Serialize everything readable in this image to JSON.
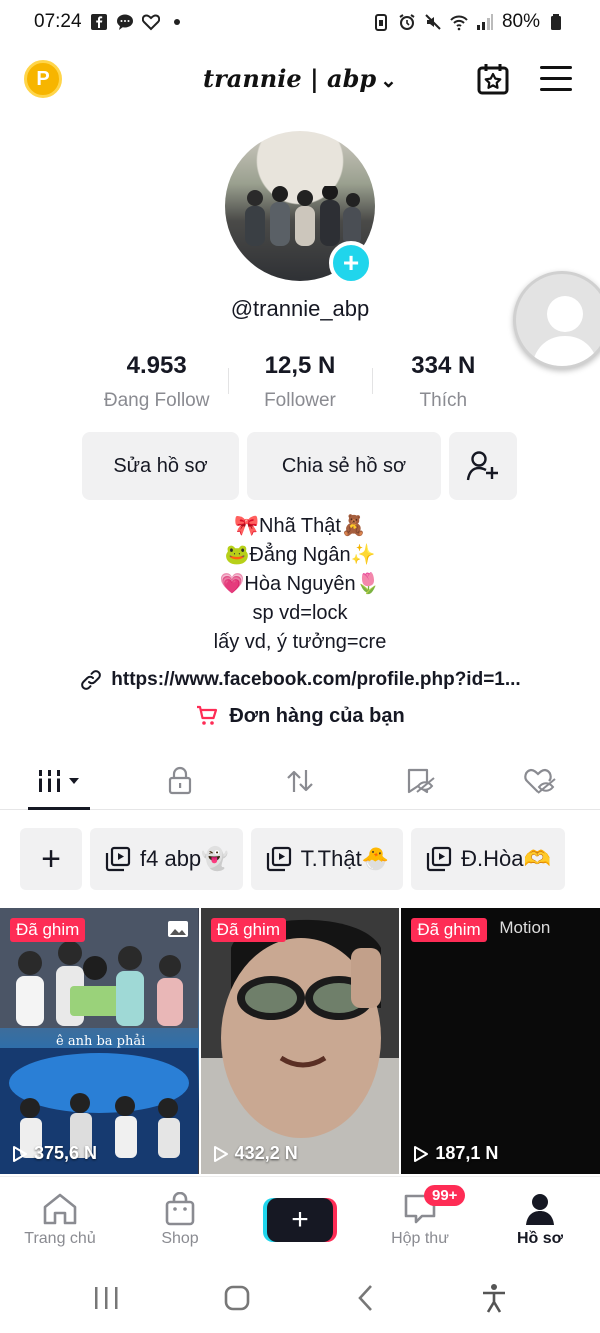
{
  "status_bar": {
    "time": "07:24",
    "battery": "80%"
  },
  "header": {
    "username": "trannie | abp",
    "coin_label": "P"
  },
  "profile": {
    "handle": "@trannie_abp",
    "stats": [
      {
        "value": "4.953",
        "label": "Đang Follow"
      },
      {
        "value": "12,5 N",
        "label": "Follower"
      },
      {
        "value": "334 N",
        "label": "Thích"
      }
    ],
    "edit_label": "Sửa hồ sơ",
    "share_label": "Chia sẻ hồ sơ",
    "bio": [
      "🎀Nhã Thật🧸",
      "🐸Đẳng Ngân✨",
      "💗Hòa Nguyên🌷",
      "sp vd=lock",
      "lấy vd, ý tưởng=cre"
    ],
    "link": "https://www.facebook.com/profile.php?id=1...",
    "orders": "Đơn hàng của bạn"
  },
  "collections": [
    {
      "label": "f4 abp👻"
    },
    {
      "label": "T.Thật🐣"
    },
    {
      "label": "Đ.Hòa🫶"
    }
  ],
  "videos": [
    {
      "pinned": "Đã ghim",
      "views": "375,6 N",
      "overlay": "ê anh ba phải"
    },
    {
      "pinned": "Đã ghim",
      "views": "432,2 N"
    },
    {
      "pinned": "Đã ghim",
      "views": "187,1 N",
      "overlay": "Motion"
    }
  ],
  "bottom_nav": [
    {
      "label": "Trang chủ"
    },
    {
      "label": "Shop"
    },
    {
      "label": ""
    },
    {
      "label": "Hộp thư",
      "badge": "99+"
    },
    {
      "label": "Hồ sơ"
    }
  ],
  "colors": {
    "accent_red": "#fe2c55",
    "accent_cyan": "#20d5ec",
    "text": "#161823",
    "secondary": "#8a8b91"
  }
}
